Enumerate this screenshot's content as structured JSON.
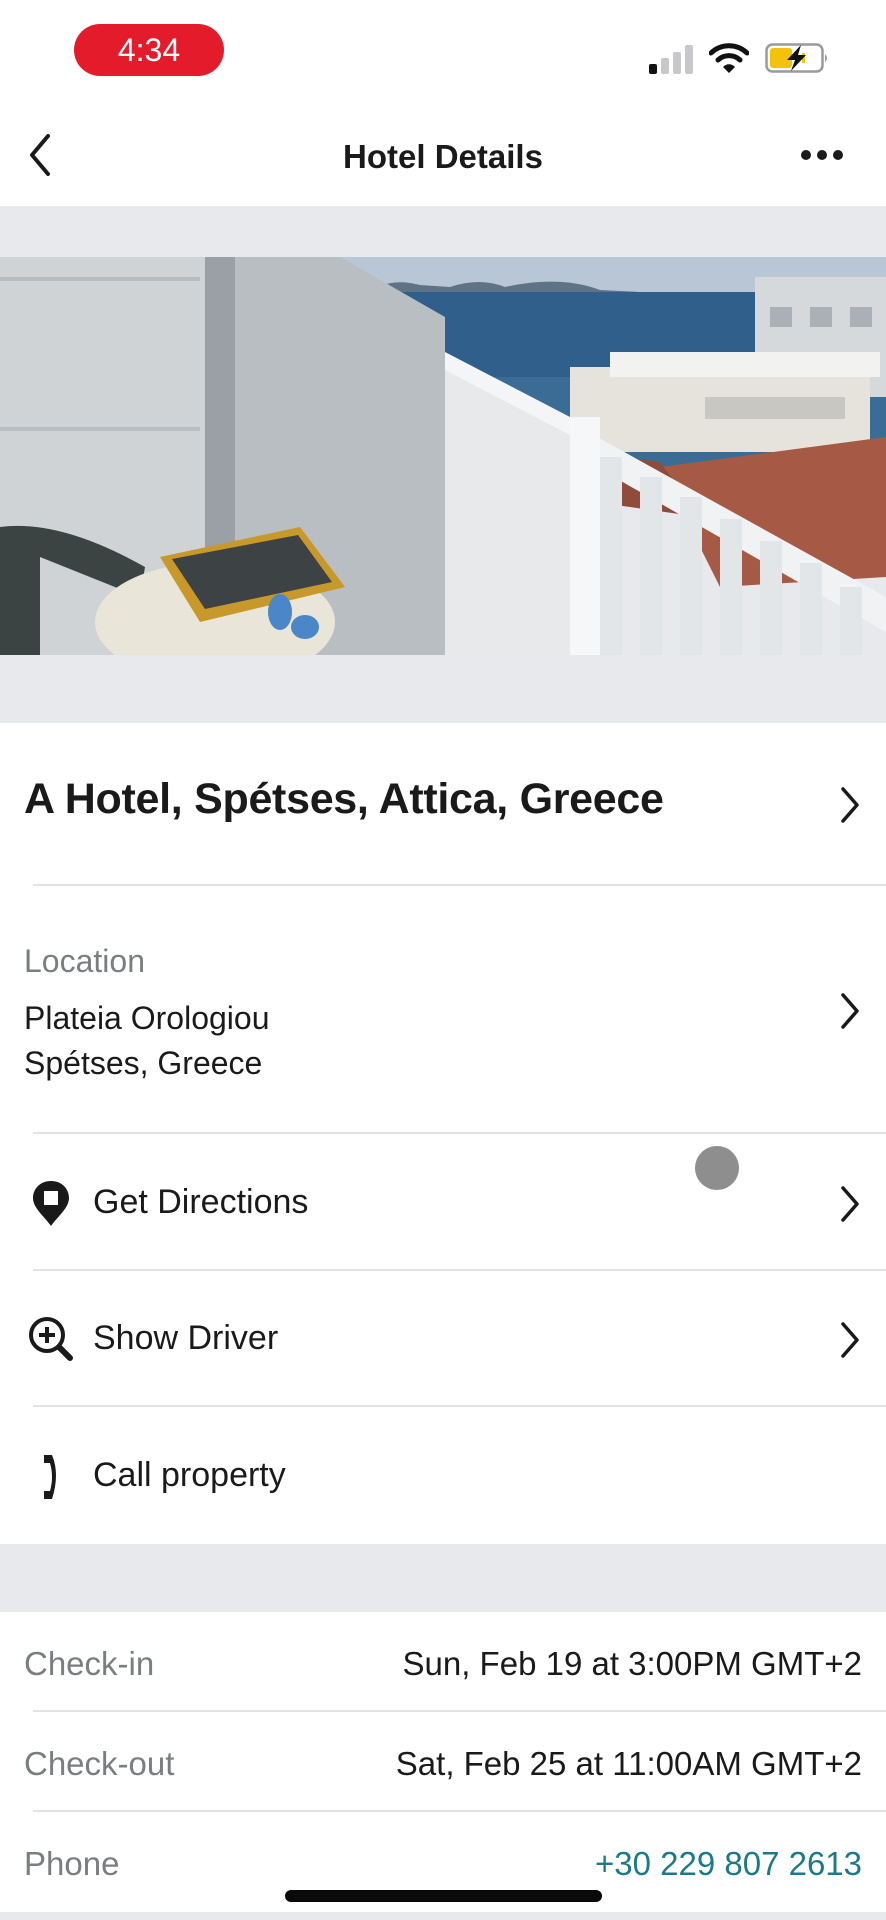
{
  "status_bar": {
    "time": "4:34",
    "signal_bars_active": 1,
    "signal_bars_total": 4,
    "battery_state": "charging",
    "colors": {
      "time_pill": "#e31b2a",
      "battery_fill": "#f4c20d"
    }
  },
  "nav": {
    "title": "Hotel Details",
    "back_icon": "chevron-left-icon",
    "more_icon": "ellipsis-icon"
  },
  "hero": {
    "alt": "Hotel balcony with table, tray and sea view"
  },
  "hotel": {
    "name": "A Hotel, Spétses, Attica, Greece"
  },
  "location": {
    "label": "Location",
    "address_line1": "Plateia Orologiou",
    "address_line2": "Spétses, Greece"
  },
  "actions": [
    {
      "label": "Get Directions",
      "icon": "map-pin-icon",
      "has_chevron": true
    },
    {
      "label": "Show Driver",
      "icon": "zoom-in-icon",
      "has_chevron": true
    },
    {
      "label": "Call property",
      "icon": "phone-icon",
      "has_chevron": false
    }
  ],
  "details": [
    {
      "label": "Check-in",
      "value": "Sun, Feb 19 at 3:00PM GMT+2"
    },
    {
      "label": "Check-out",
      "value": "Sat, Feb 25 at 11:00AM GMT+2"
    },
    {
      "label": "Phone",
      "value": "+30 229 807 2613",
      "link": true
    }
  ],
  "colors": {
    "accent_link": "#1b7a86",
    "section_gray": "#e7e9ed",
    "secondary_text": "#7a7d82"
  }
}
